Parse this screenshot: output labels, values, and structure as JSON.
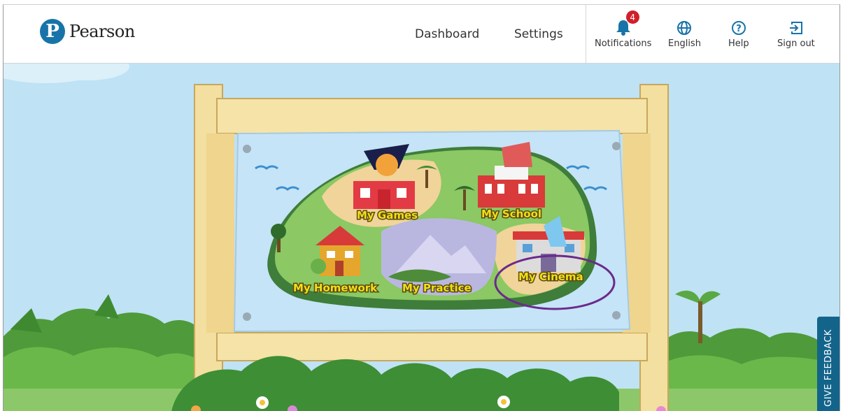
{
  "brand": {
    "name": "Pearson",
    "mark": "P"
  },
  "nav": {
    "dashboard": "Dashboard",
    "settings": "Settings"
  },
  "actions": {
    "notifications": {
      "label": "Notifications",
      "count": "4"
    },
    "language": {
      "label": "English"
    },
    "help": {
      "label": "Help"
    },
    "signout": {
      "label": "Sign out"
    }
  },
  "map": {
    "areas": {
      "games": "My Games",
      "school": "My School",
      "homework": "My Homework",
      "practice": "My Practice",
      "cinema": "My Cinema"
    },
    "highlight": "My Cinema"
  },
  "feedback": {
    "label": "GIVE FEEDBACK"
  },
  "colors": {
    "brand_blue": "#1874a8",
    "badge_red": "#d0202a",
    "feedback_bg": "#13648a",
    "highlight_ring": "#6b2a8c",
    "label_yellow": "#f2de17"
  }
}
